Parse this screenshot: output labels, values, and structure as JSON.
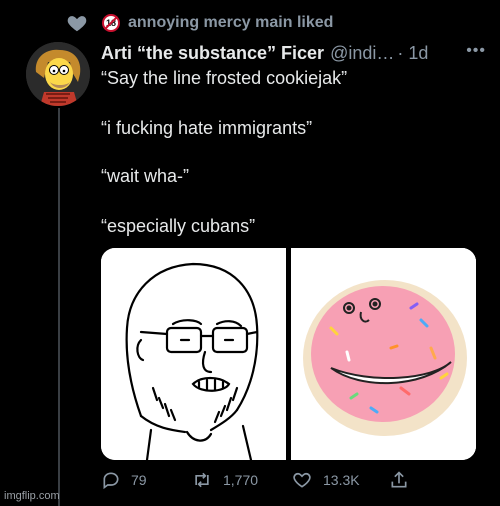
{
  "social_context": {
    "text": "annoying mercy main liked",
    "badge": "18"
  },
  "tweet": {
    "display_name": "Arti “the substance” Ficer",
    "handle": "@indi…",
    "time": "· 1d",
    "more": "•••",
    "lines": [
      "“Say the line frosted cookiejak”",
      "“i fucking hate immigrants”",
      "“wait wha-”",
      "“especially cubans”"
    ]
  },
  "actions": {
    "replies": "79",
    "retweets": "1,770",
    "likes": "13.3K"
  },
  "watermark": "imgflip.com",
  "colors": {
    "background": "#000000",
    "text": "#e7e9ea",
    "muted": "#8b98a5",
    "cookie_pink": "#f7a0b4"
  }
}
